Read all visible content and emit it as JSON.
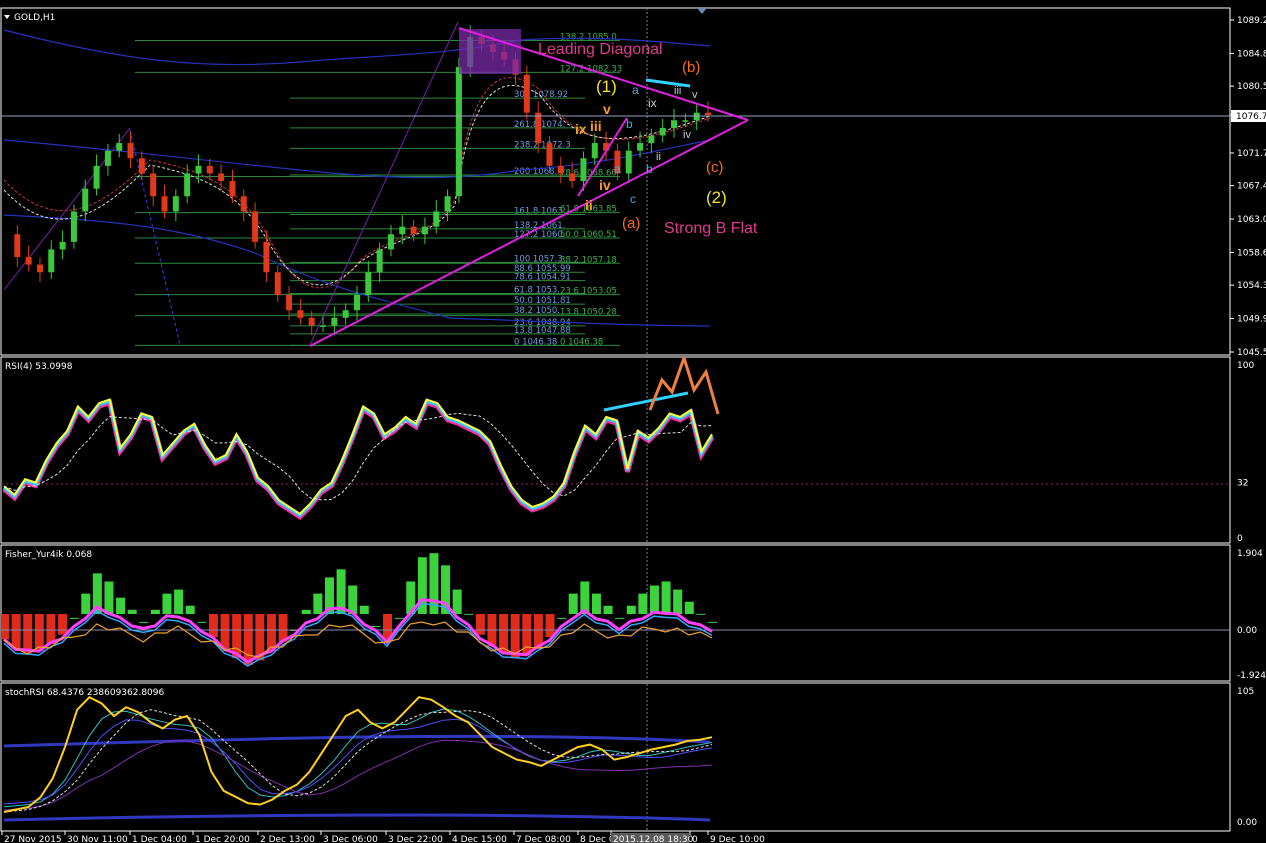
{
  "chart_data": [
    {
      "type": "line",
      "title": "GOLD,H1",
      "pane": "price",
      "ylim": [
        1045.5,
        1089.2
      ],
      "y_ticks": [
        "1089.2",
        "1084.8",
        "1080.5",
        "1076.7",
        "1071.7",
        "1067.4",
        "1063.0",
        "1058.6",
        "1054.3",
        "1049.9",
        "1045.5"
      ],
      "current_price": "1076.7",
      "x_tick_labels": [
        "27 Nov 2015",
        "30 Nov 11:00",
        "1 Dec 04:00",
        "1 Dec 20:00",
        "2 Dec 13:00",
        "3 Dec 06:00",
        "3 Dec 22:00",
        "4 Dec 15:00",
        "7 Dec 08:00",
        "8 Dec 0",
        "2015.12.08 18:30",
        "0",
        "9 Dec 10:00"
      ],
      "close_series": [
        1061,
        1058,
        1057,
        1056,
        1059,
        1060,
        1064,
        1067,
        1070,
        1072,
        1073,
        1071,
        1069,
        1066,
        1064,
        1066,
        1069,
        1070,
        1069,
        1068,
        1066,
        1064,
        1060,
        1056,
        1053,
        1051,
        1050,
        1049,
        1049,
        1050,
        1051,
        1053,
        1056,
        1059,
        1061,
        1062,
        1061,
        1062,
        1064,
        1066,
        1083,
        1087,
        1086,
        1085,
        1084,
        1082,
        1077,
        1073,
        1070,
        1069,
        1068,
        1071,
        1073,
        1072,
        1069,
        1072,
        1073,
        1074,
        1075,
        1076,
        1076,
        1077,
        1076.7
      ],
      "fib_left": [
        {
          "text": "300 1078.92",
          "value": 1078.92
        },
        {
          "text": "261.8 1074.",
          "value": 1075.0
        },
        {
          "text": "238.2 1072.3",
          "value": 1072.3
        },
        {
          "text": "200 1068.",
          "value": 1068.8
        },
        {
          "text": "161.8 1063.",
          "value": 1063.6
        },
        {
          "text": "138.2 1061.",
          "value": 1061.7
        },
        {
          "text": "127.2 1060.",
          "value": 1060.5
        },
        {
          "text": "100 1057.3",
          "value": 1057.3
        },
        {
          "text": "88.6 1055.99",
          "value": 1056.0
        },
        {
          "text": "78.6 1054.91",
          "value": 1054.9
        },
        {
          "text": "61.8 1053.",
          "value": 1053.2
        },
        {
          "text": "50.0 1051.81",
          "value": 1051.8
        },
        {
          "text": "38.2 1050.",
          "value": 1050.5
        },
        {
          "text": "23.6 1048.94",
          "value": 1048.94
        },
        {
          "text": "13.8 1047.88",
          "value": 1047.88
        },
        {
          "text": "0 1046.38",
          "value": 1046.38
        }
      ],
      "fib_right": [
        {
          "text": "138.2 1085.0",
          "value": 1086.5
        },
        {
          "text": "127.2 1082.33",
          "value": 1082.3
        },
        {
          "text": "78.6 1068.60",
          "value": 1068.6
        },
        {
          "text": "61.8 1063.85",
          "value": 1063.85
        },
        {
          "text": "50.0 1060.51",
          "value": 1060.51
        },
        {
          "text": "38.2 1057.18",
          "value": 1057.18
        },
        {
          "text": "23.6 1053.05",
          "value": 1053.05
        },
        {
          "text": "13.8 1050.28",
          "value": 1050.28
        },
        {
          "text": "0 1046.38",
          "value": 1046.38
        }
      ],
      "annotations": {
        "leading_diagonal": "Leading Diagonal",
        "strong_b_flat": "Strong B Flat",
        "wave_1": "(1)",
        "wave_2": "(2)",
        "wave_a": "(a)",
        "wave_b": "(b)",
        "wave_c": "(c)",
        "w_v": "v",
        "w_ix": "ix",
        "w_iii": "iii",
        "w_iv": "iv",
        "w_ii": "ii",
        "w_a_small": "a",
        "w_b_small": "b",
        "w_c_small": "c",
        "w_a2_small": "a",
        "w_b2_small": "b",
        "w_ix2": "ix",
        "w_iii2": "iii",
        "w_v2": "v",
        "w_iv2": "iv",
        "w_ii2": "ii"
      }
    },
    {
      "type": "line",
      "title": "RSI(4) 53.0998",
      "pane": "rsi",
      "ylim": [
        0,
        100
      ],
      "y_ticks": [
        "100",
        "32",
        "0"
      ],
      "series": [
        {
          "values": [
            30,
            25,
            34,
            32,
            45,
            55,
            62,
            76,
            70,
            78,
            80,
            52,
            60,
            72,
            70,
            48,
            55,
            62,
            66,
            54,
            45,
            48,
            60,
            50,
            35,
            30,
            22,
            18,
            14,
            20,
            28,
            32,
            45,
            60,
            76,
            72,
            60,
            64,
            70,
            66,
            80,
            78,
            70,
            68,
            65,
            62,
            56,
            42,
            30,
            22,
            18,
            20,
            24,
            32,
            50,
            65,
            60,
            70,
            68,
            40,
            62,
            58,
            64,
            72,
            70,
            74,
            50,
            60
          ]
        }
      ]
    },
    {
      "type": "bar",
      "title": "Fisher_Yur4ik 0.068",
      "pane": "fisher",
      "ylim": [
        -1.924,
        1.904
      ],
      "y_ticks": [
        "1.904",
        "0.00",
        "-1.924"
      ],
      "series": [
        {
          "values": [
            -0.4,
            -0.8,
            -1.0,
            -0.9,
            -0.6,
            -0.2,
            0.3,
            0.9,
            1.4,
            1.2,
            0.8,
            0.5,
            0.2,
            0.5,
            0.9,
            1.0,
            0.6,
            0.2,
            -0.3,
            -0.8,
            -1.2,
            -1.5,
            -1.3,
            -0.9,
            -0.5,
            0.0,
            0.5,
            0.9,
            1.3,
            1.5,
            1.1,
            0.6,
            0.1,
            -0.4,
            0.3,
            1.2,
            1.8,
            1.9,
            1.6,
            1.0,
            0.4,
            -0.2,
            -0.7,
            -1.0,
            -1.2,
            -1.1,
            -0.8,
            -0.3,
            0.3,
            0.9,
            1.2,
            0.9,
            0.6,
            0.3,
            0.6,
            0.9,
            1.1,
            1.2,
            1.0,
            0.7,
            0.4,
            0.2
          ]
        }
      ]
    },
    {
      "type": "line",
      "title": "stochRSI 68.4376 238609362.8096",
      "pane": "stochrsi",
      "ylim": [
        0,
        105
      ],
      "y_ticks": [
        "105",
        "0.00"
      ],
      "series": [
        {
          "values": [
            8,
            10,
            12,
            20,
            35,
            60,
            90,
            100,
            95,
            85,
            92,
            88,
            80,
            75,
            82,
            85,
            70,
            40,
            25,
            20,
            15,
            14,
            18,
            25,
            30,
            40,
            55,
            70,
            85,
            90,
            80,
            75,
            80,
            90,
            100,
            98,
            92,
            85,
            80,
            70,
            60,
            55,
            50,
            48,
            45,
            50,
            55,
            60,
            62,
            58,
            50,
            52,
            55,
            58,
            60,
            62,
            65,
            66,
            68
          ]
        }
      ]
    }
  ]
}
